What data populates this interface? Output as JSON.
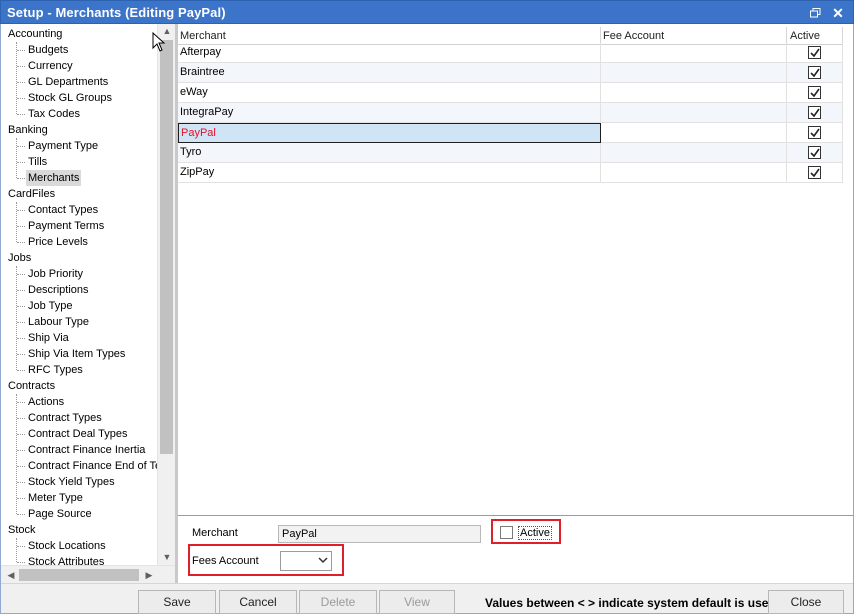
{
  "window": {
    "title": "Setup - Merchants (Editing PayPal)",
    "restore_label": "restore",
    "close_label": "✕"
  },
  "tree": {
    "groups": [
      {
        "label": "Accounting",
        "items": [
          "Budgets",
          "Currency",
          "GL Departments",
          "Stock GL Groups",
          "Tax Codes"
        ]
      },
      {
        "label": "Banking",
        "items": [
          "Payment Type",
          "Tills",
          "Merchants"
        ]
      },
      {
        "label": "CardFiles",
        "items": [
          "Contact Types",
          "Payment Terms",
          "Price Levels"
        ]
      },
      {
        "label": "Jobs",
        "items": [
          "Job Priority",
          "Descriptions",
          "Job Type",
          "Labour Type",
          "Ship Via",
          "Ship Via Item Types",
          "RFC Types"
        ]
      },
      {
        "label": "Contracts",
        "items": [
          "Actions",
          "Contract Types",
          "Contract Deal Types",
          "Contract Finance Inertia",
          "Contract Finance End of Te",
          "Stock Yield Types",
          "Meter Type",
          "Page Source"
        ]
      },
      {
        "label": "Stock",
        "items": [
          "Stock Locations",
          "Stock Attributes"
        ]
      }
    ],
    "selected": "Merchants"
  },
  "grid": {
    "columns": [
      "Merchant",
      "Fee Account",
      "Active"
    ],
    "rows": [
      {
        "merchant": "Afterpay",
        "fee_account": "",
        "active": true
      },
      {
        "merchant": "Braintree",
        "fee_account": "",
        "active": true
      },
      {
        "merchant": "eWay",
        "fee_account": "",
        "active": true
      },
      {
        "merchant": "IntegraPay",
        "fee_account": "",
        "active": true
      },
      {
        "merchant": "PayPal",
        "fee_account": "",
        "active": true
      },
      {
        "merchant": "Tyro",
        "fee_account": "",
        "active": true
      },
      {
        "merchant": "ZipPay",
        "fee_account": "",
        "active": true
      }
    ],
    "selected_row": "PayPal",
    "selected_color": "#e8102a"
  },
  "edit": {
    "merchant_label": "Merchant",
    "merchant_value": "PayPal",
    "active_label": "Active",
    "active_checked": false,
    "fees_account_label": "Fees Account",
    "fees_account_value": ""
  },
  "footer": {
    "save": "Save",
    "cancel": "Cancel",
    "delete": "Delete",
    "view": "View",
    "note": "Values between < > indicate system default is use",
    "close": "Close"
  },
  "colors": {
    "title_bar": "#3b74c8",
    "highlight_box": "#e01f2d",
    "selection": "#cfe4f5"
  }
}
